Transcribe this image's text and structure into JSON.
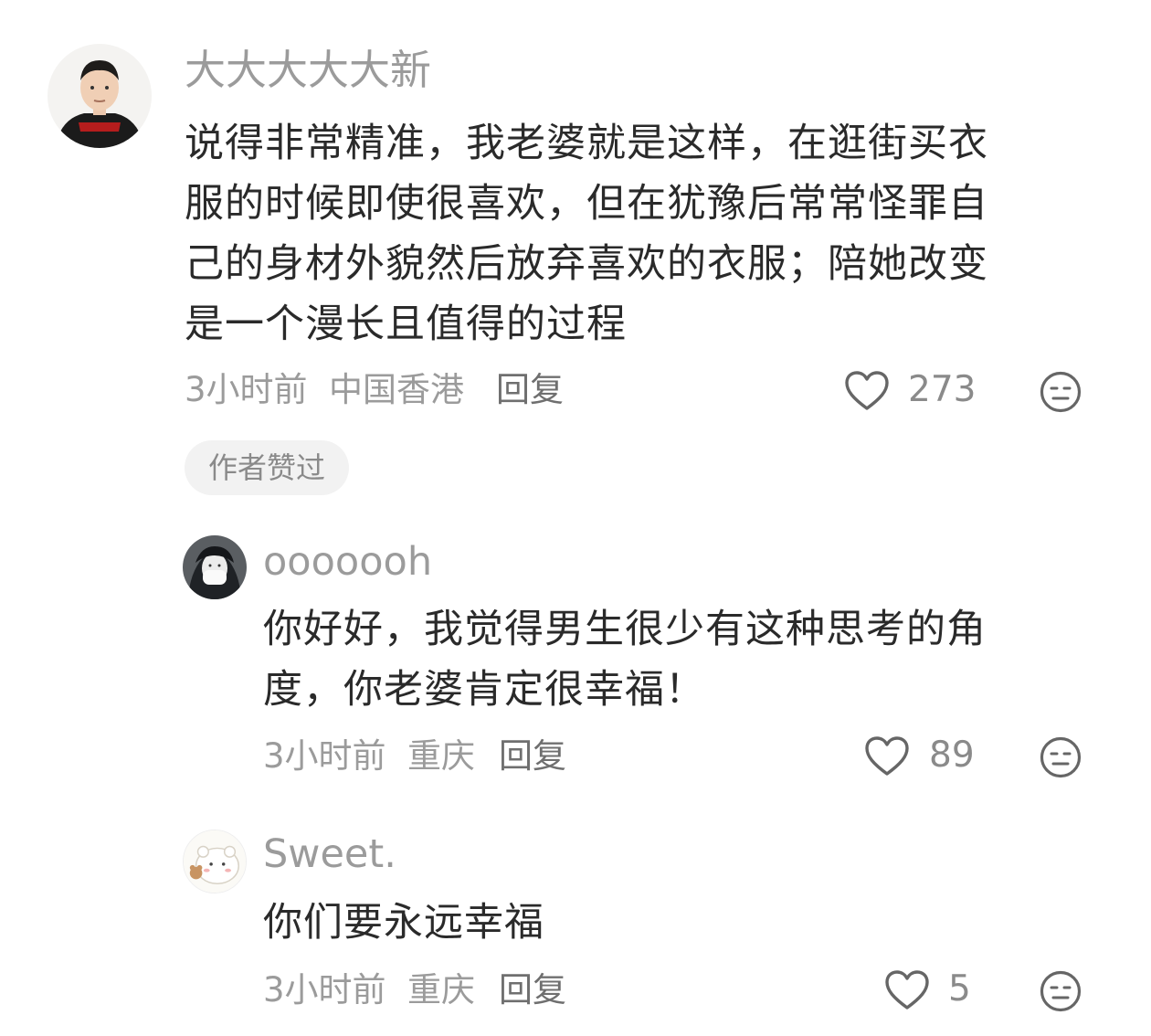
{
  "comments": [
    {
      "username": "大大大大大新",
      "lines": [
        "说得非常精准，我老婆就是这样，在逛街买衣",
        "服的时候即使很喜欢，但在犹豫后常常怪罪自",
        "己的身材外貌然后放弃喜欢的衣服；陪她改变",
        "是一个漫长且值得的过程"
      ],
      "time": "3小时前",
      "location": "中国香港",
      "reply_label": "回复",
      "likes": "273",
      "badge": "作者赞过",
      "avatar_icon": "user-photo-avatar",
      "like_icon": "heart-outline-icon",
      "dislike_icon": "meh-face-icon"
    },
    {
      "username": "ooooooh",
      "lines": [
        "你好好，我觉得男生很少有这种思考的角",
        "度，你老婆肯定很幸福！"
      ],
      "time": "3小时前",
      "location": "重庆",
      "reply_label": "回复",
      "likes": "89",
      "avatar_icon": "user-photo-avatar",
      "like_icon": "heart-outline-icon",
      "dislike_icon": "meh-face-icon"
    },
    {
      "username": "Sweet.",
      "lines": [
        "你们要永远幸福"
      ],
      "time": "3小时前",
      "location": "重庆",
      "reply_label": "回复",
      "likes": "5",
      "avatar_icon": "cartoon-bear-avatar",
      "like_icon": "heart-outline-icon",
      "dislike_icon": "meh-face-icon"
    }
  ],
  "colors": {
    "text_primary": "#2a2a2a",
    "text_secondary": "#9b9b9b",
    "badge_bg": "#f2f2f2"
  }
}
